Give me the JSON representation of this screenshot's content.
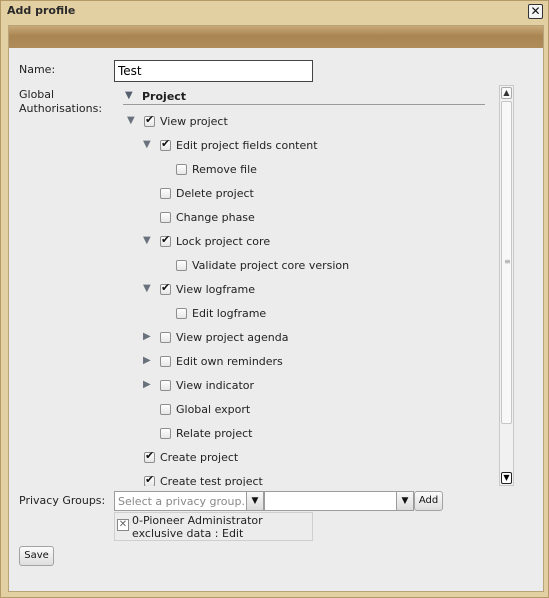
{
  "window": {
    "title": "Add profile",
    "close_glyph": "✕"
  },
  "form": {
    "name_label": "Name:",
    "name_value": "Test",
    "global_auth_label_line1": "Global",
    "global_auth_label_line2": "Authorisations:"
  },
  "tree": {
    "section_title": "Project",
    "nodes": [
      {
        "label": "View project",
        "checked": true,
        "expander": "expanded"
      },
      {
        "label": "Edit project fields content",
        "checked": true,
        "expander": "expanded"
      },
      {
        "label": "Remove file",
        "checked": false,
        "expander": "none"
      },
      {
        "label": "Delete project",
        "checked": false,
        "expander": "none"
      },
      {
        "label": "Change phase",
        "checked": false,
        "expander": "none"
      },
      {
        "label": "Lock project core",
        "checked": true,
        "expander": "expanded"
      },
      {
        "label": "Validate project core version",
        "checked": false,
        "expander": "none"
      },
      {
        "label": "View logframe",
        "checked": true,
        "expander": "expanded"
      },
      {
        "label": "Edit logframe",
        "checked": false,
        "expander": "none"
      },
      {
        "label": "View project agenda",
        "checked": false,
        "expander": "collapsed"
      },
      {
        "label": "Edit own reminders",
        "checked": false,
        "expander": "collapsed"
      },
      {
        "label": "View indicator",
        "checked": false,
        "expander": "collapsed"
      },
      {
        "label": "Global export",
        "checked": false,
        "expander": "none"
      },
      {
        "label": "Relate project",
        "checked": false,
        "expander": "none"
      },
      {
        "label": "Create project",
        "checked": true,
        "expander": "none"
      },
      {
        "label": "Create test project",
        "checked": true,
        "expander": "none"
      }
    ]
  },
  "privacy": {
    "label": "Privacy Groups:",
    "select_placeholder": "Select a privacy group.",
    "second_select_value": "",
    "add_label": "Add",
    "assigned_line1": "0-Pioneer Administrator",
    "assigned_line2": "exclusive data : Edit",
    "remove_glyph": "✕"
  },
  "save_label": "Save",
  "icons": {
    "expanded": "▼",
    "collapsed": "▶",
    "dropdown": "▼",
    "scroll_up": "▲",
    "scroll_down": "▼",
    "grip": "≡"
  }
}
